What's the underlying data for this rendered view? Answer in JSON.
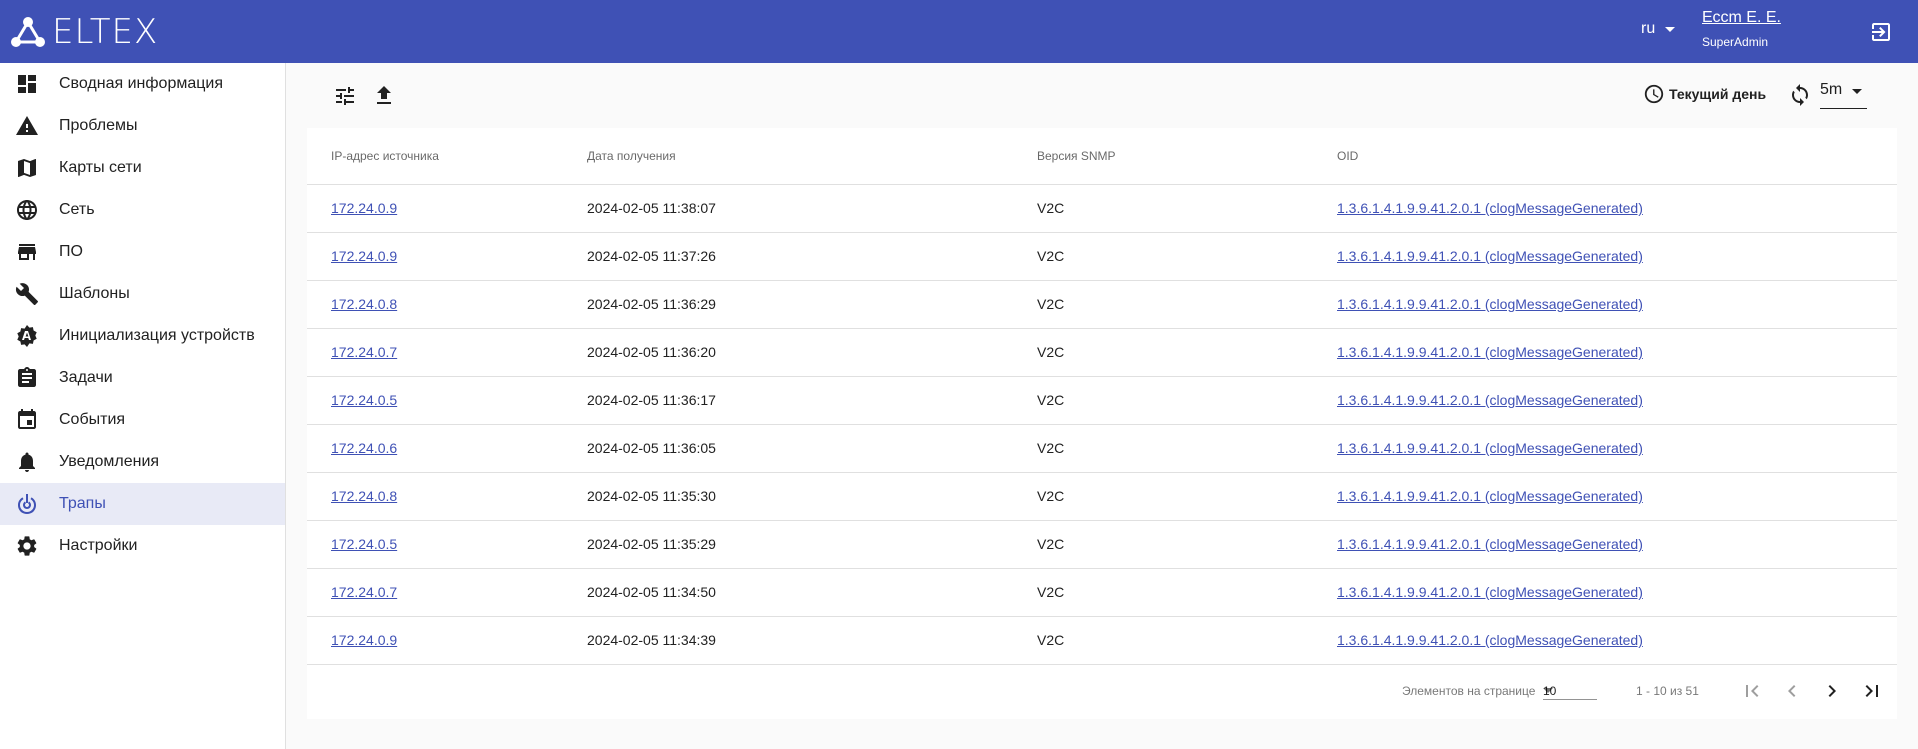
{
  "header": {
    "logo_text": "ELTEX",
    "language": "ru",
    "user_name": "Ессm Е. Е.",
    "user_role": "SuperAdmin",
    "bg_color": "#3f51b5"
  },
  "sidebar": {
    "items": [
      {
        "label": "Сводная информация",
        "icon": "dashboard-icon"
      },
      {
        "label": "Проблемы",
        "icon": "warning-icon"
      },
      {
        "label": "Карты сети",
        "icon": "map-icon"
      },
      {
        "label": "Сеть",
        "icon": "globe-icon"
      },
      {
        "label": "ПО",
        "icon": "store-icon"
      },
      {
        "label": "Шаблоны",
        "icon": "wrench-icon"
      },
      {
        "label": "Инициализация устройств",
        "icon": "auto-gear-icon"
      },
      {
        "label": "Задачи",
        "icon": "clipboard-icon"
      },
      {
        "label": "События",
        "icon": "calendar-icon"
      },
      {
        "label": "Уведомления",
        "icon": "bell-icon"
      },
      {
        "label": "Трапы",
        "icon": "trap-icon",
        "active": true
      },
      {
        "label": "Настройки",
        "icon": "gear-icon"
      }
    ]
  },
  "toolbar": {
    "period_label": "Текущий день",
    "refresh_interval": "5m"
  },
  "table": {
    "columns": [
      "IP-адрес источника",
      "Дата получения",
      "Версия SNMP",
      "OID"
    ],
    "rows": [
      {
        "ip": "172.24.0.9",
        "date": "2024-02-05 11:38:07",
        "snmp": "V2C",
        "oid": "1.3.6.1.4.1.9.9.41.2.0.1 (clogMessageGenerated)"
      },
      {
        "ip": "172.24.0.9",
        "date": "2024-02-05 11:37:26",
        "snmp": "V2C",
        "oid": "1.3.6.1.4.1.9.9.41.2.0.1 (clogMessageGenerated)"
      },
      {
        "ip": "172.24.0.8",
        "date": "2024-02-05 11:36:29",
        "snmp": "V2C",
        "oid": "1.3.6.1.4.1.9.9.41.2.0.1 (clogMessageGenerated)"
      },
      {
        "ip": "172.24.0.7",
        "date": "2024-02-05 11:36:20",
        "snmp": "V2C",
        "oid": "1.3.6.1.4.1.9.9.41.2.0.1 (clogMessageGenerated)"
      },
      {
        "ip": "172.24.0.5",
        "date": "2024-02-05 11:36:17",
        "snmp": "V2C",
        "oid": "1.3.6.1.4.1.9.9.41.2.0.1 (clogMessageGenerated)"
      },
      {
        "ip": "172.24.0.6",
        "date": "2024-02-05 11:36:05",
        "snmp": "V2C",
        "oid": "1.3.6.1.4.1.9.9.41.2.0.1 (clogMessageGenerated)"
      },
      {
        "ip": "172.24.0.8",
        "date": "2024-02-05 11:35:30",
        "snmp": "V2C",
        "oid": "1.3.6.1.4.1.9.9.41.2.0.1 (clogMessageGenerated)"
      },
      {
        "ip": "172.24.0.5",
        "date": "2024-02-05 11:35:29",
        "snmp": "V2C",
        "oid": "1.3.6.1.4.1.9.9.41.2.0.1 (clogMessageGenerated)"
      },
      {
        "ip": "172.24.0.7",
        "date": "2024-02-05 11:34:50",
        "snmp": "V2C",
        "oid": "1.3.6.1.4.1.9.9.41.2.0.1 (clogMessageGenerated)"
      },
      {
        "ip": "172.24.0.9",
        "date": "2024-02-05 11:34:39",
        "snmp": "V2C",
        "oid": "1.3.6.1.4.1.9.9.41.2.0.1 (clogMessageGenerated)"
      }
    ]
  },
  "paginator": {
    "items_per_page_label": "Элементов на странице",
    "page_size": "10",
    "range_label": "1 - 10 из 51"
  }
}
